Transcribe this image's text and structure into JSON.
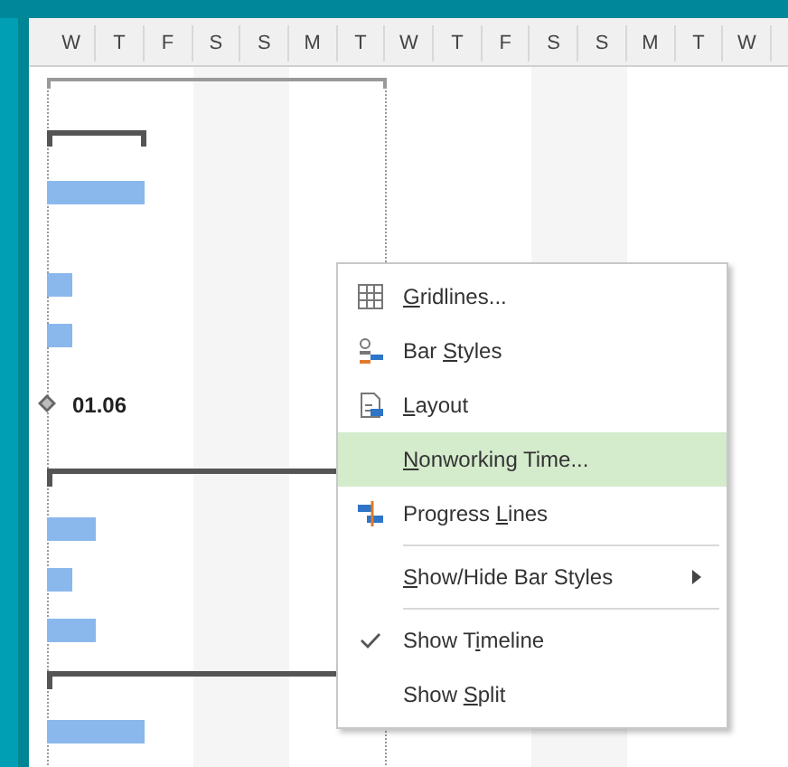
{
  "timescale": {
    "days": [
      "W",
      "T",
      "F",
      "S",
      "S",
      "M",
      "T",
      "W",
      "T",
      "F",
      "S",
      "S",
      "M",
      "T",
      "W"
    ]
  },
  "gantt": {
    "milestone_label": "01.06"
  },
  "context_menu": {
    "items": [
      {
        "access_key": "G",
        "text_after": "ridlines...",
        "selected": false
      },
      {
        "text_before": "Bar ",
        "access_key": "S",
        "text_after": "tyles",
        "selected": false
      },
      {
        "access_key": "L",
        "text_after": "ayout",
        "selected": false
      },
      {
        "access_key": "N",
        "text_after": "onworking Time...",
        "selected": true
      },
      {
        "text_before": "Progress ",
        "access_key": "L",
        "text_after": "ines",
        "selected": false
      },
      {
        "access_key": "S",
        "text_after": "how/Hide Bar Styles",
        "selected": false,
        "submenu": true,
        "separator_before": true
      },
      {
        "text_before": "Show T",
        "access_key": "i",
        "text_after": "meline",
        "selected": false,
        "checked": true,
        "separator_before": true
      },
      {
        "text_before": "Show ",
        "access_key": "S",
        "text_after": "plit",
        "selected": false,
        "checked": false
      }
    ]
  }
}
